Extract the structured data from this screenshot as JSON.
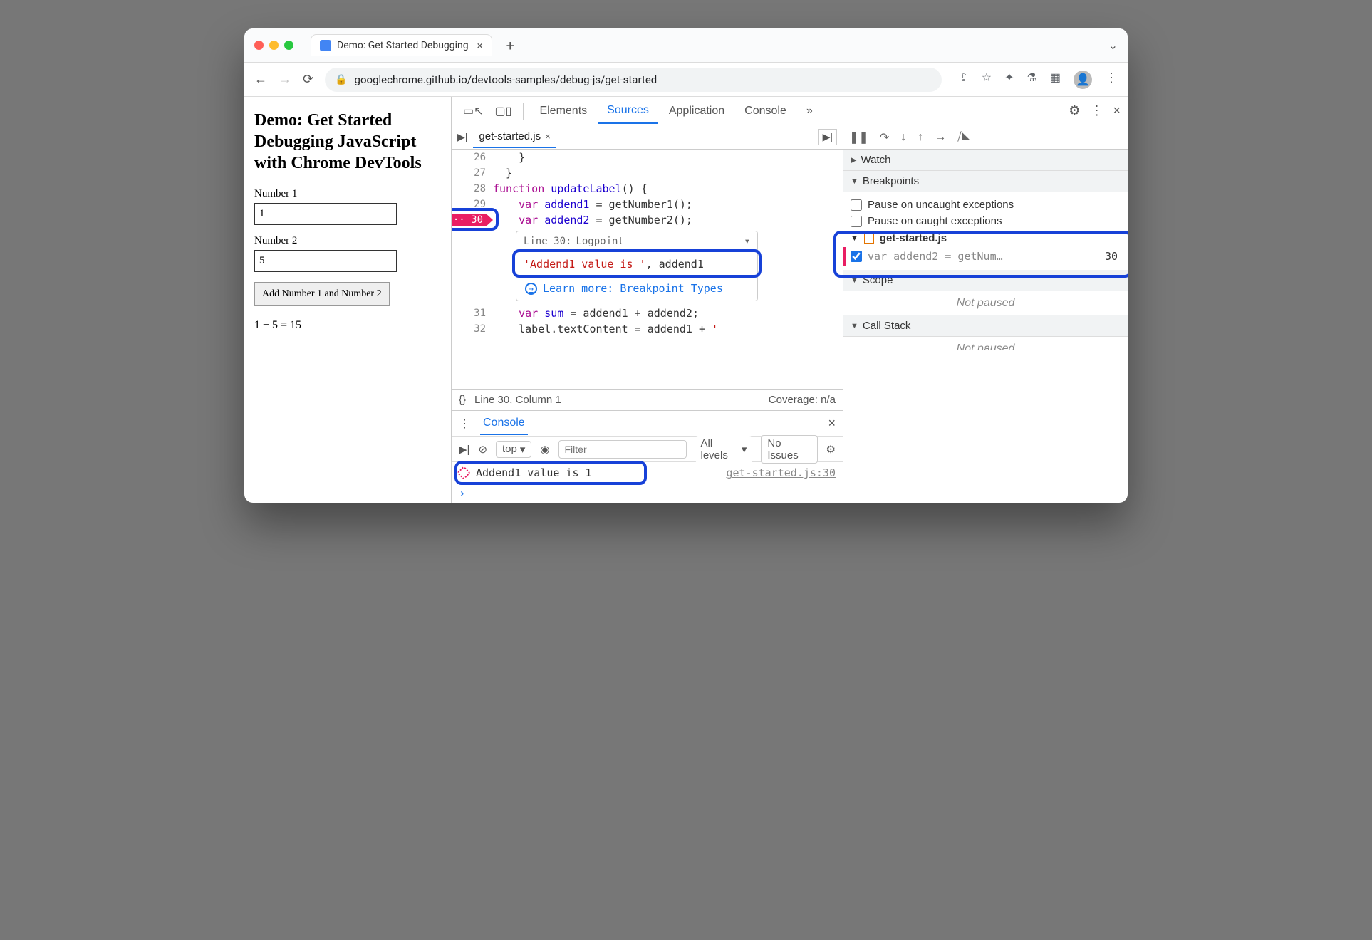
{
  "browser": {
    "tab_title": "Demo: Get Started Debugging",
    "url": "googlechrome.github.io/devtools-samples/debug-js/get-started"
  },
  "page": {
    "heading": "Demo: Get Started Debugging JavaScript with Chrome DevTools",
    "label1": "Number 1",
    "value1": "1",
    "label2": "Number 2",
    "value2": "5",
    "button": "Add Number 1 and Number 2",
    "result": "1 + 5 = 15"
  },
  "devtools": {
    "tabs": {
      "elements": "Elements",
      "sources": "Sources",
      "application": "Application",
      "console": "Console",
      "more": "»"
    },
    "file_tab": "get-started.js",
    "code_lines": {
      "26": "    }",
      "27": "  }",
      "28": "function updateLabel() {",
      "29": "    var addend1 = getNumber1();",
      "30": "    var addend2 = getNumber2();",
      "31": "    var sum = addend1 + addend2;",
      "32": "    label.textContent = addend1 + ' "
    },
    "logpoint_line": "30",
    "popover": {
      "head_line": "Line 30:",
      "head_type": "Logpoint",
      "expression_str": "'Addend1 value is '",
      "expression_var": ", addend1",
      "link": "Learn more: Breakpoint Types"
    },
    "status": {
      "braces": "{}",
      "pos": "Line 30, Column 1",
      "coverage": "Coverage: n/a"
    },
    "right": {
      "watch": "Watch",
      "breakpoints": "Breakpoints",
      "pause_uncaught": "Pause on uncaught exceptions",
      "pause_caught": "Pause on caught exceptions",
      "bp_file": "get-started.js",
      "bp_code": "var addend2 = getNum…",
      "bp_linenum": "30",
      "scope": "Scope",
      "not_paused": "Not paused",
      "call_stack": "Call Stack"
    },
    "console": {
      "title": "Console",
      "context": "top",
      "filter_placeholder": "Filter",
      "levels": "All levels",
      "issues": "No Issues",
      "log_text": "Addend1 value is  1",
      "log_source": "get-started.js:30"
    }
  }
}
